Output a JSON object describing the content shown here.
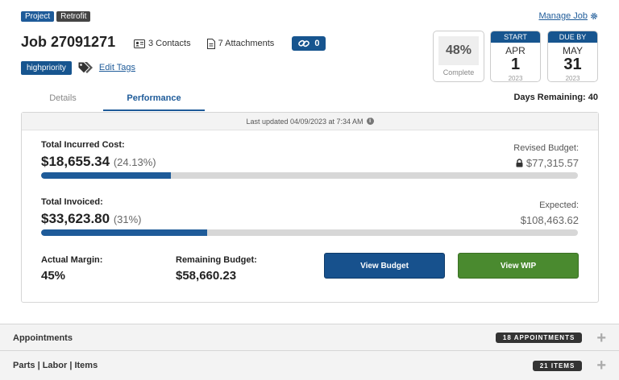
{
  "header": {
    "tags": [
      "Project",
      "Retrofit"
    ],
    "manage_job": "Manage Job",
    "job_title": "Job 27091271",
    "contacts": "3 Contacts",
    "attachments": "7 Attachments",
    "links_count": "0",
    "priority_tag": "highpriority",
    "edit_tags": "Edit Tags"
  },
  "progress_card": {
    "value": "48%",
    "label": "Complete"
  },
  "start_card": {
    "head": "START",
    "month": "APR",
    "day": "1",
    "year": "2023"
  },
  "due_card": {
    "head": "DUE BY",
    "month": "MAY",
    "day": "31",
    "year": "2023"
  },
  "tabs": [
    {
      "label": "Details",
      "active": false
    },
    {
      "label": "Performance",
      "active": true
    }
  ],
  "days_remaining": "Days Remaining: 40",
  "performance": {
    "last_updated": "Last updated 04/09/2023 at 7:34 AM",
    "incurred": {
      "label": "Total Incurred Cost:",
      "value": "$18,655.34",
      "pct": "(24.13%)",
      "progress": 0.2413,
      "right_label": "Revised Budget:",
      "right_value": "$77,315.57"
    },
    "invoiced": {
      "label": "Total Invoiced:",
      "value": "$33,623.80",
      "pct": "(31%)",
      "progress": 0.31,
      "right_label": "Expected:",
      "right_value": "$108,463.62"
    },
    "margin": {
      "label": "Actual Margin:",
      "value": "45%"
    },
    "remaining": {
      "label": "Remaining Budget:",
      "value": "$58,660.23"
    },
    "view_budget": "View Budget",
    "view_wip": "View WIP"
  },
  "sections": [
    {
      "title": "Appointments",
      "badge": "18 APPOINTMENTS"
    },
    {
      "title": "Parts | Labor | Items",
      "badge": "21 ITEMS"
    }
  ],
  "colors": {
    "primary": "#1e5b99",
    "success": "#4a8a2f",
    "dark_badge": "#333333"
  },
  "icons": {
    "manage_job": "gear-icon",
    "contacts": "contact-card-icon",
    "attachments": "document-icon",
    "links": "link-icon",
    "tags": "tags-icon",
    "lock": "lock-icon",
    "info": "info-icon",
    "expand": "plus-icon"
  }
}
